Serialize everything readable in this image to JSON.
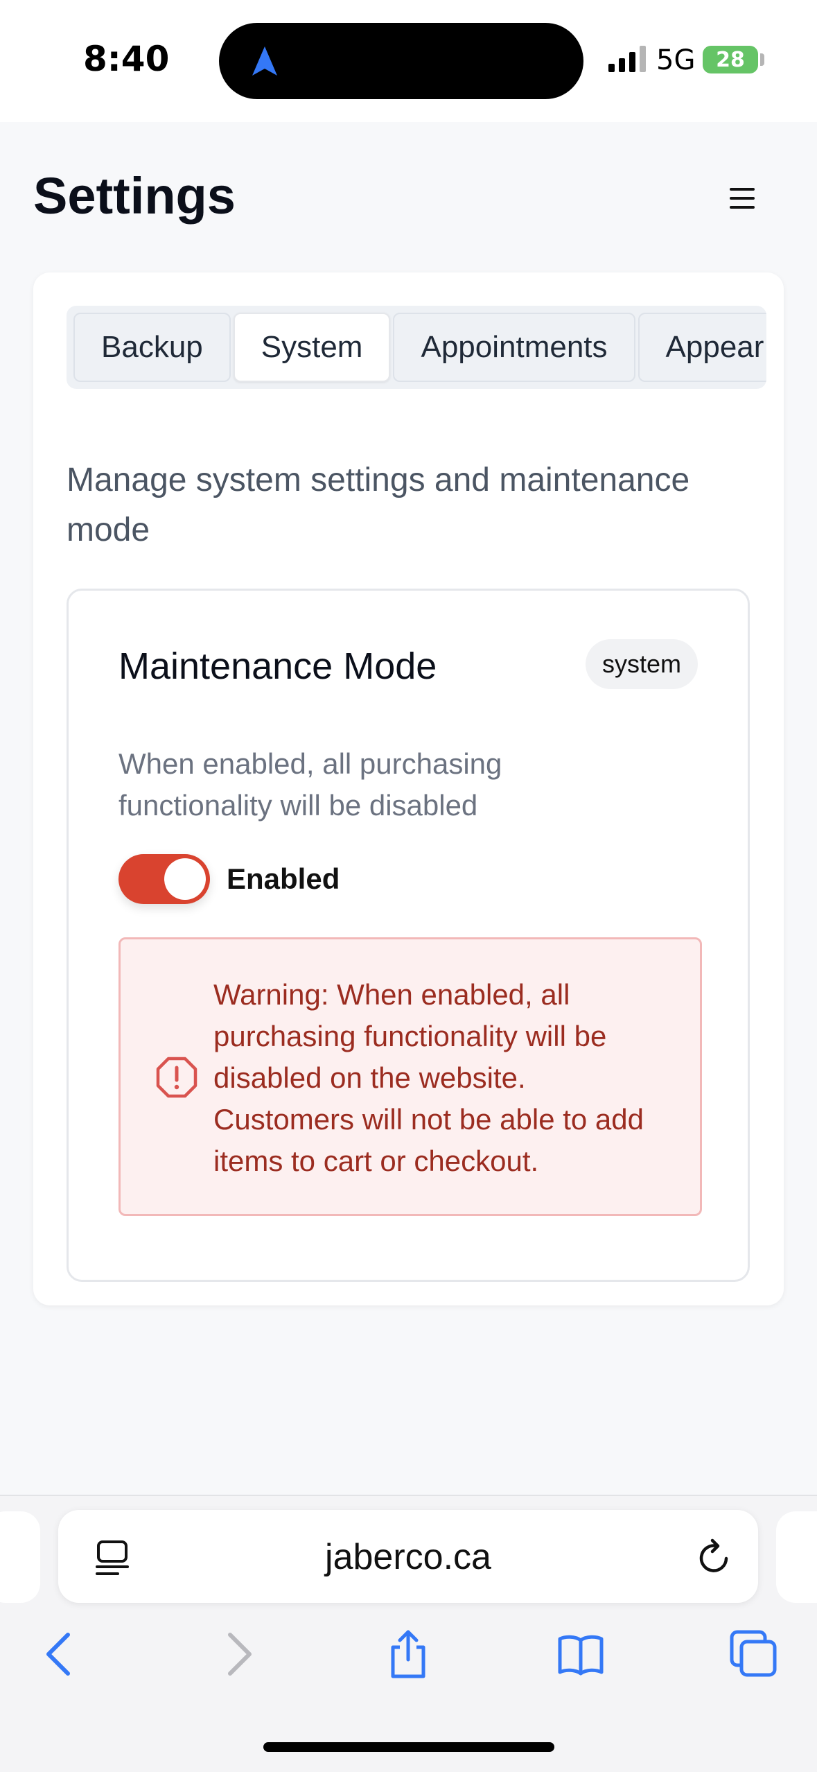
{
  "status_bar": {
    "time": "8:40",
    "network": "5G",
    "battery": "28"
  },
  "header": {
    "title": "Settings"
  },
  "tabs": [
    {
      "label": "Backup",
      "active": false
    },
    {
      "label": "System",
      "active": true
    },
    {
      "label": "Appointments",
      "active": false
    },
    {
      "label": "Appear",
      "active": false
    }
  ],
  "main": {
    "description": "Manage system settings and maintenance mode",
    "setting": {
      "title": "Maintenance Mode",
      "badge": "system",
      "description": "When enabled, all purchasing functionality will be disabled",
      "toggle_label": "Enabled",
      "toggle_on": true,
      "warning": "Warning: When enabled, all purchasing functionality will be disabled on the website. Customers will not be able to add items to cart or checkout."
    }
  },
  "browser": {
    "url": "jaberco.ca"
  },
  "colors": {
    "accent": "#d9432f",
    "warning_text": "#9b2c20",
    "warning_bg": "#fdf0f0",
    "ios_blue": "#3478f6"
  }
}
